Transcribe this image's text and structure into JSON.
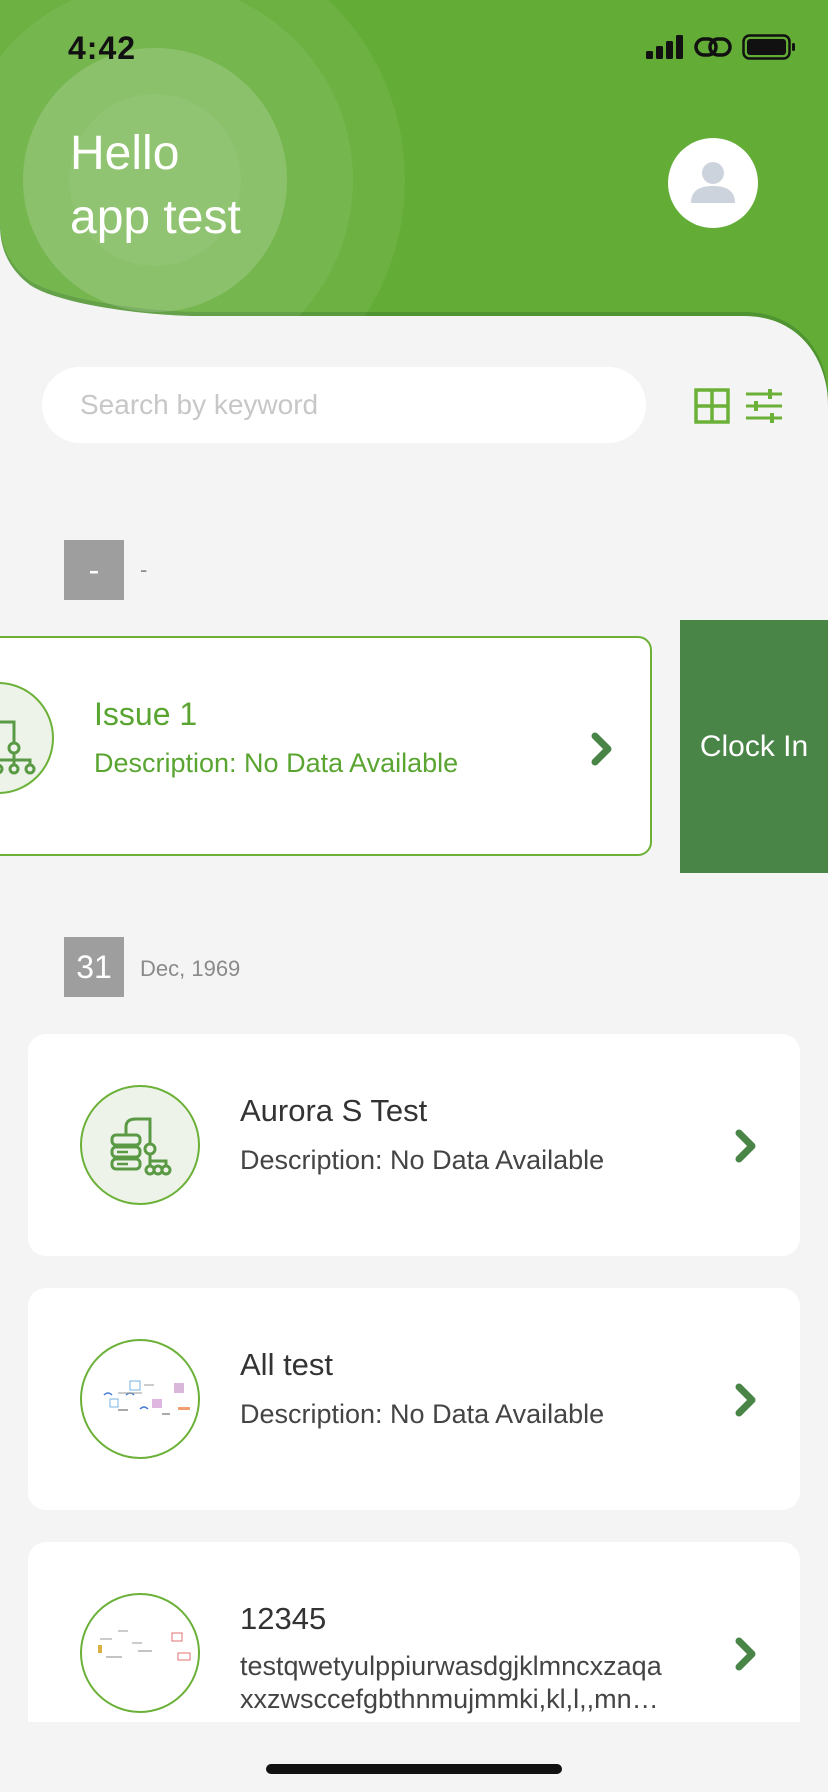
{
  "status_bar": {
    "time": "4:42"
  },
  "header": {
    "greeting_line1": "Hello",
    "greeting_line2": "app test"
  },
  "search": {
    "placeholder": "Search by keyword",
    "value": ""
  },
  "colors": {
    "primary_green": "#6bb138",
    "dark_green": "#4a8548",
    "date_box": "#9e9e9e"
  },
  "groups": [
    {
      "date_day": "-",
      "date_month_year": "-",
      "items": [
        {
          "title": "Issue 1",
          "description": "Description: No Data Available",
          "action_label": "Clock In",
          "icon": "hierarchy-icon"
        }
      ]
    },
    {
      "date_day": "31",
      "date_month_year": "Dec, 1969",
      "items": [
        {
          "title": "Aurora S Test",
          "description": "Description: No Data Available",
          "icon": "hierarchy-icon"
        },
        {
          "title": "All test",
          "description": "Description: No Data Available",
          "icon": "diagram-thumbnail"
        },
        {
          "title": "12345",
          "description": "testqwetyulppiurwasdgjklmncxzaqa xxzwsccefgbthnmujmmki,kl,l,,mn…",
          "icon": "diagram-thumbnail"
        }
      ]
    }
  ]
}
